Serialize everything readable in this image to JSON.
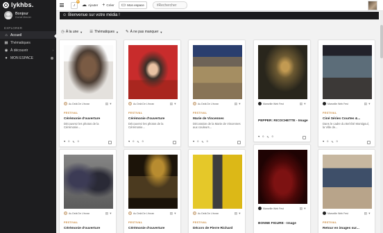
{
  "sidebar": {
    "logo": "lykhbs.",
    "user": {
      "greeting": "Bonjour",
      "name": "Cornel Mercier"
    },
    "section": "EXPLORER",
    "items": [
      {
        "label": "Accueil",
        "icon": "home-icon"
      },
      {
        "label": "Thématiques",
        "icon": "tag-icon"
      },
      {
        "label": "À découvrir",
        "icon": "compass-icon"
      },
      {
        "label": "MON ESPACE",
        "icon": "user-icon"
      }
    ]
  },
  "topbar": {
    "notification_count": "10",
    "ajouter": "Ajouter",
    "creer": "Créer",
    "mon_espace": "Mon espace",
    "search_placeholder": "#Rechercher"
  },
  "welcome": "Bienvenue sur votre média !",
  "filters": [
    {
      "label": "À la une",
      "icon": "clock-icon"
    },
    {
      "label": "Thématiques",
      "icon": "list-icon"
    },
    {
      "label": "À ne pas manquer",
      "icon": "pin-icon"
    }
  ],
  "cards": [
    {
      "author": "Au Delà De L'écran",
      "category": "FESTIVAL",
      "title": "Cérémonie d'ouverture",
      "desc": "Découvrez les photos de la Cérémonie...",
      "likes": "0",
      "comments": "0"
    },
    {
      "author": "Au Delà De L'écran",
      "category": "FESTIVAL",
      "title": "Cérémonie d'ouverture",
      "desc": "Découvrez les photos de la Cérémonie...",
      "likes": "0",
      "comments": "0"
    },
    {
      "author": "Au Delà De L'écran",
      "category": "FESTIVAL",
      "title": "Marie de Vincennes",
      "desc": "Décoration de la Marie de Vincennes aux couleurs...",
      "likes": "0",
      "comments": "0"
    },
    {
      "author": "Marseille Web Fest",
      "category": "",
      "title": "PEPPER: RICOCHETTE - Image",
      "desc": "",
      "likes": "0",
      "comments": "0"
    },
    {
      "author": "Marseille Web Fest",
      "category": "FESTIVAL",
      "title": "Ciné Séries Courtes &...",
      "desc": "Dans le cadre du Bel Été Montigoul, la Ville de...",
      "likes": "0",
      "comments": "0"
    },
    {
      "author": "Au Delà De L'écran",
      "category": "FESTIVAL",
      "title": "Cérémonie d'ouverture",
      "desc": "",
      "likes": "",
      "comments": ""
    },
    {
      "author": "Au Delà De L'écran",
      "category": "FESTIVAL",
      "title": "Cérémonie d'ouverture",
      "desc": "",
      "likes": "",
      "comments": ""
    },
    {
      "author": "Au Delà De L'écran",
      "category": "FESTIVAL",
      "title": "Décors de Pierre Richard",
      "desc": "",
      "likes": "",
      "comments": ""
    },
    {
      "author": "Marseille Web Fest",
      "category": "",
      "title": "BONNE FIGURE - Image",
      "desc": "",
      "likes": "",
      "comments": ""
    },
    {
      "author": "Marseille Web Fest",
      "category": "FESTIVAL",
      "title": "Retour en images sur...",
      "desc": "",
      "likes": "",
      "comments": ""
    }
  ]
}
